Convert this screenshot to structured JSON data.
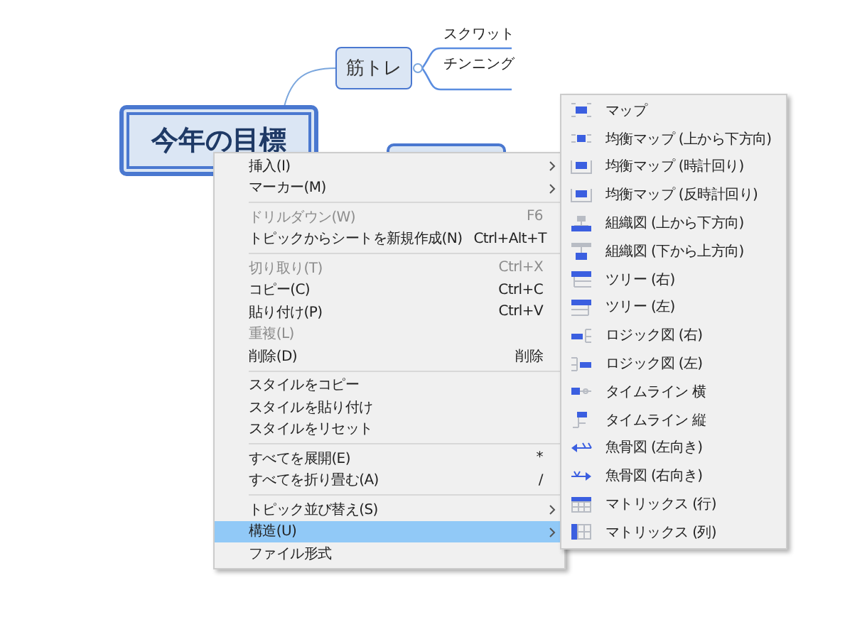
{
  "mindmap": {
    "central_topic": {
      "text": "今年の目標"
    },
    "topics": [
      {
        "text": "筋トレ",
        "children": [
          {
            "text": "スクワット"
          },
          {
            "text": "チンニング"
          }
        ]
      }
    ]
  },
  "context_menu": {
    "items": [
      {
        "kind": "item",
        "label": "挿入(I)",
        "submenu": true,
        "disabled": false,
        "selected": false
      },
      {
        "kind": "item",
        "label": "マーカー(M)",
        "submenu": true,
        "disabled": false,
        "selected": false
      },
      {
        "kind": "separator"
      },
      {
        "kind": "item",
        "label": "ドリルダウン(W)",
        "shortcut": "F6",
        "submenu": false,
        "disabled": true,
        "selected": false
      },
      {
        "kind": "item",
        "label": "トピックからシートを新規作成(N)",
        "shortcut": "Ctrl+Alt+T",
        "submenu": false,
        "disabled": false,
        "selected": false
      },
      {
        "kind": "separator"
      },
      {
        "kind": "item",
        "label": "切り取り(T)",
        "shortcut": "Ctrl+X",
        "submenu": false,
        "disabled": true,
        "selected": false
      },
      {
        "kind": "item",
        "label": "コピー(C)",
        "shortcut": "Ctrl+C",
        "submenu": false,
        "disabled": false,
        "selected": false
      },
      {
        "kind": "item",
        "label": "貼り付け(P)",
        "shortcut": "Ctrl+V",
        "submenu": false,
        "disabled": false,
        "selected": false
      },
      {
        "kind": "item",
        "label": "重複(L)",
        "submenu": false,
        "disabled": true,
        "selected": false
      },
      {
        "kind": "item",
        "label": "削除(D)",
        "shortcut": "削除",
        "submenu": false,
        "disabled": false,
        "selected": false
      },
      {
        "kind": "separator"
      },
      {
        "kind": "item",
        "label": "スタイルをコピー",
        "submenu": false,
        "disabled": false,
        "selected": false
      },
      {
        "kind": "item",
        "label": "スタイルを貼り付け",
        "submenu": false,
        "disabled": false,
        "selected": false
      },
      {
        "kind": "item",
        "label": "スタイルをリセット",
        "submenu": false,
        "disabled": false,
        "selected": false
      },
      {
        "kind": "separator"
      },
      {
        "kind": "item",
        "label": "すべてを展開(E)",
        "shortcut": "*",
        "submenu": false,
        "disabled": false,
        "selected": false
      },
      {
        "kind": "item",
        "label": "すべてを折り畳む(A)",
        "shortcut": "/",
        "submenu": false,
        "disabled": false,
        "selected": false
      },
      {
        "kind": "separator"
      },
      {
        "kind": "item",
        "label": "トピック並び替え(S)",
        "submenu": true,
        "disabled": false,
        "selected": false
      },
      {
        "kind": "item",
        "label": "構造(U)",
        "submenu": true,
        "disabled": false,
        "selected": true
      },
      {
        "kind": "item",
        "label": "ファイル形式",
        "submenu": false,
        "disabled": false,
        "selected": false
      }
    ]
  },
  "structure_submenu": {
    "items": [
      {
        "kind": "map",
        "label": "マップ"
      },
      {
        "kind": "balanced",
        "label": "均衡マップ (上から下方向)"
      },
      {
        "kind": "clockwise",
        "label": "均衡マップ (時計回り)"
      },
      {
        "kind": "counterclockwise",
        "label": "均衡マップ (反時計回り)"
      },
      {
        "kind": "org-down",
        "label": "組織図 (上から下方向)"
      },
      {
        "kind": "org-up",
        "label": "組織図 (下から上方向)"
      },
      {
        "kind": "tree-right",
        "label": "ツリー (右)"
      },
      {
        "kind": "tree-left",
        "label": "ツリー (左)"
      },
      {
        "kind": "logic-right",
        "label": "ロジック図 (右)"
      },
      {
        "kind": "logic-left",
        "label": "ロジック図 (左)"
      },
      {
        "kind": "timeline-h",
        "label": "タイムライン 横"
      },
      {
        "kind": "timeline-v",
        "label": "タイムライン 縦"
      },
      {
        "kind": "fish-left",
        "label": "魚骨図 (左向き)"
      },
      {
        "kind": "fish-right",
        "label": "魚骨図 (右向き)"
      },
      {
        "kind": "matrix-row",
        "label": "マトリックス (行)"
      },
      {
        "kind": "matrix-col",
        "label": "マトリックス (列)"
      }
    ]
  }
}
